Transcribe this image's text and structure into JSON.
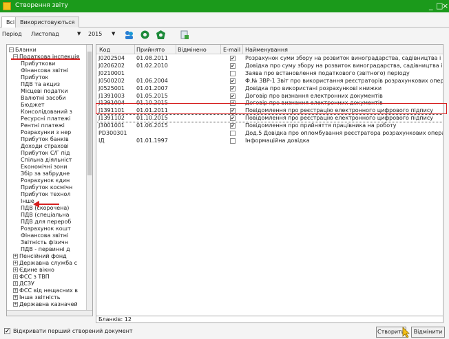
{
  "window": {
    "title": "Створення звіту",
    "controls": [
      "_",
      "□",
      "×"
    ]
  },
  "tabs": [
    "Всі",
    "Використовуються"
  ],
  "toolbar": {
    "period_label": "Період",
    "month": "Листопад",
    "year": "2015"
  },
  "tree": {
    "items": [
      {
        "label": "Бланки",
        "box": "−"
      },
      {
        "label": "Податкова інспекція",
        "box": "−"
      },
      {
        "label": "Прибуткови"
      },
      {
        "label": "Фінансова звітні"
      },
      {
        "label": "Прибуток"
      },
      {
        "label": "ПДВ та акциз"
      },
      {
        "label": "Місцеві податки"
      },
      {
        "label": "Валютні засоби"
      },
      {
        "label": "Бюджет"
      },
      {
        "label": "Консолідований з"
      },
      {
        "label": "Ресурсні платежі"
      },
      {
        "label": "Рентні платежі"
      },
      {
        "label": "Розрахунки з нер"
      },
      {
        "label": "Прибуток банків"
      },
      {
        "label": "Доходи страхові"
      },
      {
        "label": "Прибуток С/Г під"
      },
      {
        "label": "Спільна діяльніст"
      },
      {
        "label": "Економічні зони"
      },
      {
        "label": "Збір за забрудне"
      },
      {
        "label": "Розрахунок єдин"
      },
      {
        "label": "Прибуток космічн"
      },
      {
        "label": "Прибуток технол"
      },
      {
        "label": "Інше"
      },
      {
        "label": "ПДВ (скорочена)"
      },
      {
        "label": "ПДВ (спеціальна"
      },
      {
        "label": "ПДВ для перероб"
      },
      {
        "label": "Розрахунок кошт"
      },
      {
        "label": "Фінансова звітні"
      },
      {
        "label": "Звітність фізичн"
      },
      {
        "label": "ПДВ - первинні д"
      },
      {
        "label": "Пенсійний фонд",
        "box": "+"
      },
      {
        "label": "Державна служба с",
        "box": "+"
      },
      {
        "label": "Єдине вікно",
        "box": "+"
      },
      {
        "label": "ФСС з ТВП",
        "box": "+"
      },
      {
        "label": "ДСЗУ",
        "box": "+"
      },
      {
        "label": "ФСС від нещасних в",
        "box": "+"
      },
      {
        "label": "Інша звітність",
        "box": "+"
      },
      {
        "label": "Державна казначей",
        "box": "+"
      }
    ]
  },
  "grid": {
    "columns": [
      "Код",
      "Прийнято",
      "Відмінено",
      "E-mail",
      "Найменування"
    ],
    "rows": [
      {
        "code": "J0202504",
        "accepted": "01.08.2011",
        "cancelled": "",
        "email": true,
        "name": "Розрахунок суми збору на розвиток виноградарства, садівництва і х..."
      },
      {
        "code": "J0206202",
        "accepted": "01.02.2010",
        "cancelled": "",
        "email": true,
        "name": "Довідка про суму збору на розвиток виноградарства, садівництва і х..."
      },
      {
        "code": "J0210001",
        "accepted": "",
        "cancelled": "",
        "email": false,
        "name": "Заява про встановлення податкового (звітного) періоду"
      },
      {
        "code": "J0500202",
        "accepted": "01.06.2004",
        "cancelled": "",
        "email": true,
        "name": "Ф.№ 3ВР-1 Звіт про використання реєстраторів розрахункових опера..."
      },
      {
        "code": "J0525001",
        "accepted": "01.01.2007",
        "cancelled": "",
        "email": true,
        "name": "Довідка про використані розрахункові книжки"
      },
      {
        "code": "J1391003",
        "accepted": "01.05.2015",
        "cancelled": "",
        "email": true,
        "name": "Договір про визнання електронних документів"
      },
      {
        "code": "J1391004",
        "accepted": "01.10.2015",
        "cancelled": "",
        "email": true,
        "name": "Договір про визнання електронних документів"
      },
      {
        "code": "J1391101",
        "accepted": "01.01.2011",
        "cancelled": "",
        "email": true,
        "name": "Повідомлення про реєстрацію електронного цифрового підпису"
      },
      {
        "code": "J1391102",
        "accepted": "01.10.2015",
        "cancelled": "",
        "email": true,
        "name": "Повідомлення про реєстрацію електронного цифрового підпису"
      },
      {
        "code": "J3001001",
        "accepted": "01.06.2015",
        "cancelled": "",
        "email": true,
        "name": "Повідомлення про прийняття працівника на роботу"
      },
      {
        "code": "PD300301",
        "accepted": "",
        "cancelled": "",
        "email": false,
        "name": "Дод.5 Довідка про опломбування реєстратора розрахункових опера..."
      },
      {
        "code": "IД",
        "accepted": "01.01.1997",
        "cancelled": "",
        "email": false,
        "name": "Інформаційна довідка"
      }
    ],
    "footer": "Бланків: 12"
  },
  "bottom": {
    "open_first_label": "Відкривати перший створений документ",
    "open_first_checked": true,
    "create_label": "Створити",
    "cancel_label": "Відмінити"
  },
  "colors": {
    "title_bar": "#1b9a1b",
    "highlight": "#d61f1f"
  }
}
